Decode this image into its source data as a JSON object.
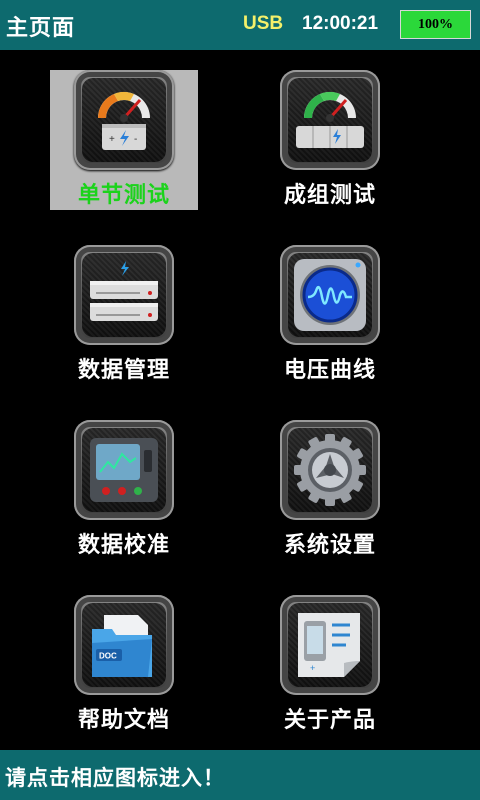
{
  "header": {
    "title": "主页面",
    "usb": "USB",
    "time": "12:00:21",
    "battery": "100%"
  },
  "menu": {
    "items": [
      {
        "label": "单节测试",
        "icon": "single-cell-test-icon",
        "selected": true
      },
      {
        "label": "成组测试",
        "icon": "group-test-icon",
        "selected": false
      },
      {
        "label": "数据管理",
        "icon": "data-management-icon",
        "selected": false
      },
      {
        "label": "电压曲线",
        "icon": "voltage-curve-icon",
        "selected": false
      },
      {
        "label": "数据校准",
        "icon": "data-calibration-icon",
        "selected": false
      },
      {
        "label": "系统设置",
        "icon": "system-settings-icon",
        "selected": false
      },
      {
        "label": "帮助文档",
        "icon": "help-document-icon",
        "selected": false
      },
      {
        "label": "关于产品",
        "icon": "about-product-icon",
        "selected": false
      }
    ]
  },
  "help_doc_badge": "DOC",
  "footer": {
    "hint": "请点击相应图标进入！"
  },
  "colors": {
    "bar": "#0d6a6e",
    "usb": "#f4f06a",
    "battery": "#2bd83a",
    "selected_label": "#1bd31b",
    "selected_bg": "#b9b9b9"
  }
}
